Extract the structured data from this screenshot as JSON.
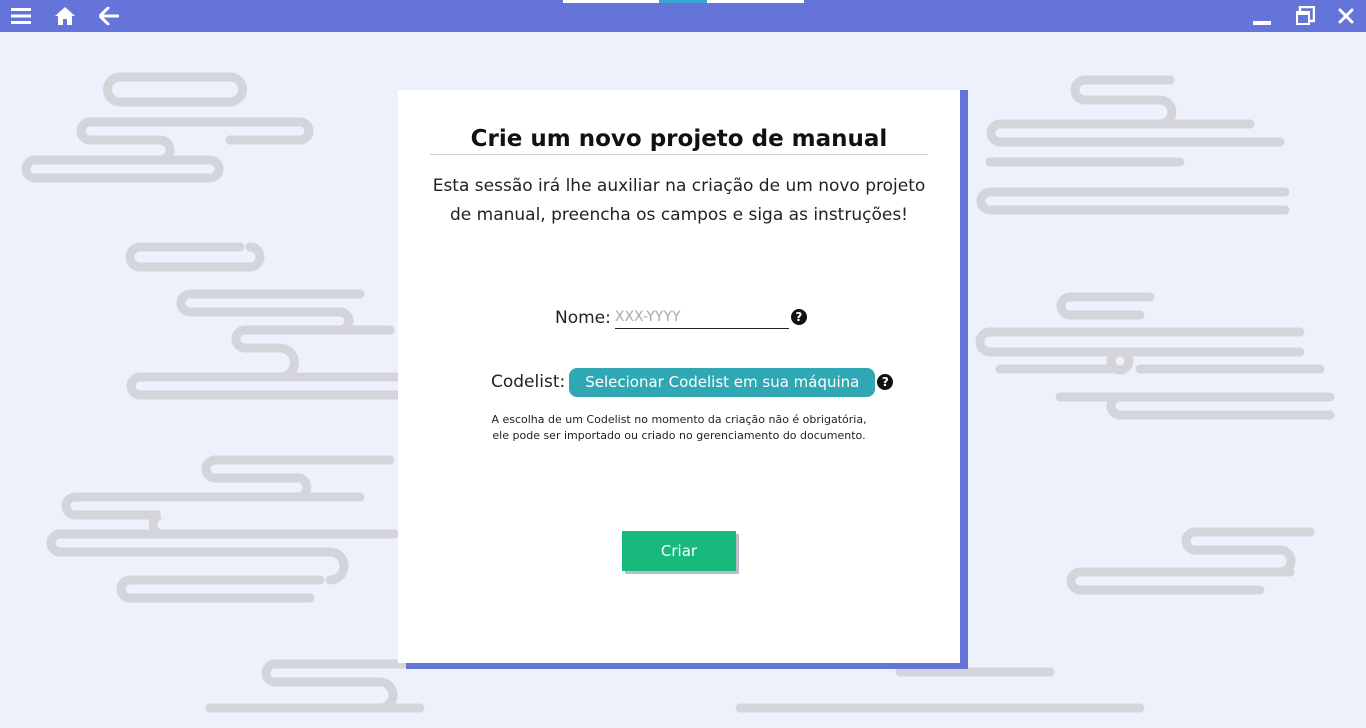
{
  "topbar": {
    "menu_icon": "hamburger-menu-icon",
    "home_icon": "home-icon",
    "back_icon": "arrow-left-icon",
    "minimize_icon": "minimize-icon",
    "restore_icon": "restore-window-icon",
    "close_icon": "close-icon"
  },
  "form": {
    "title": "Crie um novo projeto de manual",
    "description": "Esta sessão irá lhe auxiliar na criação de um novo projeto de manual, preencha os campos e siga as instruções!",
    "nome_label": "Nome:",
    "nome_placeholder": "XXX-YYYY",
    "nome_value": "",
    "codelist_label": "Codelist:",
    "codelist_button": "Selecionar Codelist em sua máquina",
    "help_glyph": "?",
    "note": "A escolha de um Codelist no momento da criação não é obrigatória, ele pode ser importado ou criado no gerenciamento do documento.",
    "submit_label": "Criar"
  },
  "colors": {
    "accent": "#6574d8",
    "codelist_button": "#2fa8b3",
    "submit_button": "#17b97c",
    "background": "#eef0fb"
  }
}
